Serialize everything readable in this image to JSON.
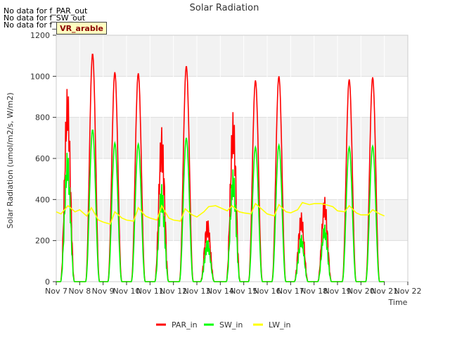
{
  "messages": [
    "No data for f_PAR_out",
    "No data for f_SW_out",
    "No data for f_LW_out"
  ],
  "site_label": "VR_arable",
  "chart_data": {
    "type": "line",
    "title": "Solar Radiation",
    "xlabel": "Time",
    "ylabel": "Solar Radiation (umol/m2/s, W/m2)",
    "ylim": [
      0,
      1200
    ],
    "xlim": [
      7,
      22
    ],
    "yticks": [
      0,
      200,
      400,
      600,
      800,
      1000,
      1200
    ],
    "xticks": [
      7,
      8,
      9,
      10,
      11,
      12,
      13,
      14,
      15,
      16,
      17,
      18,
      19,
      20,
      21,
      22
    ],
    "xtick_labels": [
      "Nov 7",
      "Nov 8",
      "Nov 9",
      "Nov 10",
      "Nov 11",
      "Nov 12",
      "Nov 13",
      "Nov 14",
      "Nov 15",
      "Nov 16",
      "Nov 17",
      "Nov 18",
      "Nov 19",
      "Nov 20",
      "Nov 21",
      "Nov 22"
    ],
    "grid": true,
    "legend": "bottom-center",
    "series": [
      {
        "name": "PAR_in",
        "color": "#ff0000",
        "daily_peaks": [
          [
            7.48,
            950
          ],
          [
            8.55,
            1110
          ],
          [
            9.5,
            1020
          ],
          [
            10.5,
            1015
          ],
          [
            11.5,
            760
          ],
          [
            12.55,
            1050
          ],
          [
            13.45,
            310
          ],
          [
            14.55,
            830
          ],
          [
            15.5,
            980
          ],
          [
            16.5,
            1000
          ],
          [
            17.45,
            340
          ],
          [
            18.45,
            415
          ],
          [
            19.5,
            985
          ],
          [
            20.5,
            995
          ]
        ]
      },
      {
        "name": "SW_in",
        "color": "#00ff00",
        "daily_peaks": [
          [
            7.48,
            635
          ],
          [
            8.55,
            740
          ],
          [
            9.5,
            675
          ],
          [
            10.5,
            670
          ],
          [
            11.5,
            480
          ],
          [
            12.55,
            700
          ],
          [
            13.45,
            210
          ],
          [
            14.55,
            550
          ],
          [
            15.5,
            655
          ],
          [
            16.5,
            665
          ],
          [
            17.45,
            230
          ],
          [
            18.45,
            280
          ],
          [
            19.5,
            655
          ],
          [
            20.5,
            660
          ]
        ]
      },
      {
        "name": "LW_in",
        "color": "#ffff00",
        "x": [
          7.0,
          7.2,
          7.5,
          7.8,
          8.0,
          8.3,
          8.5,
          8.8,
          9.0,
          9.3,
          9.5,
          9.8,
          10.0,
          10.3,
          10.5,
          10.8,
          11.0,
          11.3,
          11.5,
          11.8,
          12.0,
          12.3,
          12.5,
          12.8,
          13.0,
          13.3,
          13.5,
          13.8,
          14.0,
          14.3,
          14.5,
          14.8,
          15.0,
          15.3,
          15.5,
          15.8,
          16.0,
          16.3,
          16.5,
          16.8,
          17.0,
          17.3,
          17.5,
          17.8,
          18.0,
          18.3,
          18.5,
          18.8,
          19.0,
          19.3,
          19.5,
          19.8,
          20.0,
          20.3,
          20.5,
          20.8,
          21.0
        ],
        "values": [
          340,
          330,
          370,
          340,
          350,
          320,
          360,
          300,
          290,
          280,
          340,
          310,
          300,
          295,
          360,
          320,
          310,
          300,
          370,
          310,
          300,
          295,
          355,
          325,
          315,
          340,
          365,
          370,
          360,
          345,
          370,
          340,
          335,
          330,
          380,
          350,
          330,
          320,
          375,
          340,
          335,
          350,
          385,
          375,
          380,
          380,
          375,
          365,
          345,
          340,
          370,
          335,
          325,
          325,
          350,
          330,
          320
        ]
      }
    ]
  }
}
